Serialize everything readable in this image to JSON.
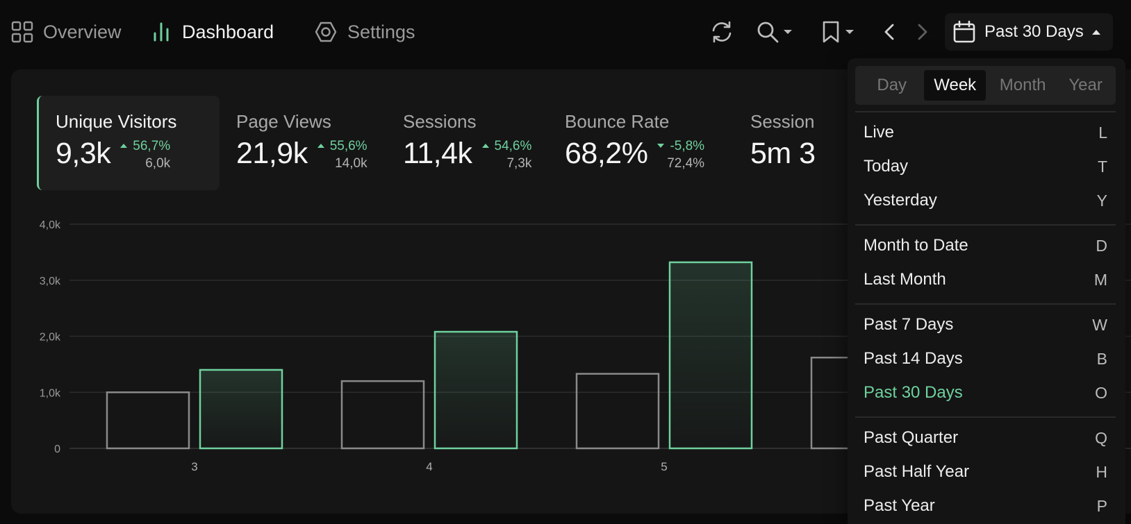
{
  "nav": {
    "overview": "Overview",
    "dashboard": "Dashboard",
    "settings": "Settings"
  },
  "toolbar": {
    "icons": [
      "refresh-icon",
      "search-icon",
      "bookmark-icon",
      "chevron-left-icon",
      "chevron-right-icon",
      "calendar-icon"
    ],
    "date_range": "Past 30 Days"
  },
  "metrics": [
    {
      "label": "Unique Visitors",
      "value": "9,3k",
      "delta": "56,7%",
      "direction": "up",
      "previous": "6,0k"
    },
    {
      "label": "Page Views",
      "value": "21,9k",
      "delta": "55,6%",
      "direction": "up",
      "previous": "14,0k"
    },
    {
      "label": "Sessions",
      "value": "11,4k",
      "delta": "54,6%",
      "direction": "up",
      "previous": "7,3k"
    },
    {
      "label": "Bounce Rate",
      "value": "68,2%",
      "delta": "-5,8%",
      "direction": "down",
      "previous": "72,4%"
    },
    {
      "label": "Session",
      "value": "5m 3"
    }
  ],
  "chart_data": {
    "type": "bar",
    "categories": [
      "3",
      "4",
      "5"
    ],
    "ylim": [
      0,
      4000
    ],
    "yticks": [
      "0",
      "1,0k",
      "2,0k",
      "3,0k",
      "4,0k"
    ],
    "grid": true,
    "series": [
      {
        "values": [
          1000,
          1200,
          1330
        ],
        "color": "#8a8a8a"
      },
      {
        "values": [
          1400,
          2080,
          3320
        ],
        "color": "#6fd19e"
      }
    ],
    "partial_next_bar": 1620
  },
  "menu": {
    "segments": [
      {
        "label": "Day",
        "active": false
      },
      {
        "label": "Week",
        "active": true
      },
      {
        "label": "Month",
        "active": false
      },
      {
        "label": "Year",
        "active": false
      }
    ],
    "groups": [
      [
        {
          "label": "Live",
          "key": "L"
        },
        {
          "label": "Today",
          "key": "T"
        },
        {
          "label": "Yesterday",
          "key": "Y"
        }
      ],
      [
        {
          "label": "Month to Date",
          "key": "D"
        },
        {
          "label": "Last Month",
          "key": "M"
        }
      ],
      [
        {
          "label": "Past 7 Days",
          "key": "W"
        },
        {
          "label": "Past 14 Days",
          "key": "B"
        },
        {
          "label": "Past 30 Days",
          "key": "O",
          "selected": true
        }
      ],
      [
        {
          "label": "Past Quarter",
          "key": "Q"
        },
        {
          "label": "Past Half Year",
          "key": "H"
        },
        {
          "label": "Past Year",
          "key": "P"
        }
      ]
    ]
  },
  "colors": {
    "accent": "#6fd19e",
    "background": "#0b0b0b",
    "card": "#151515"
  }
}
